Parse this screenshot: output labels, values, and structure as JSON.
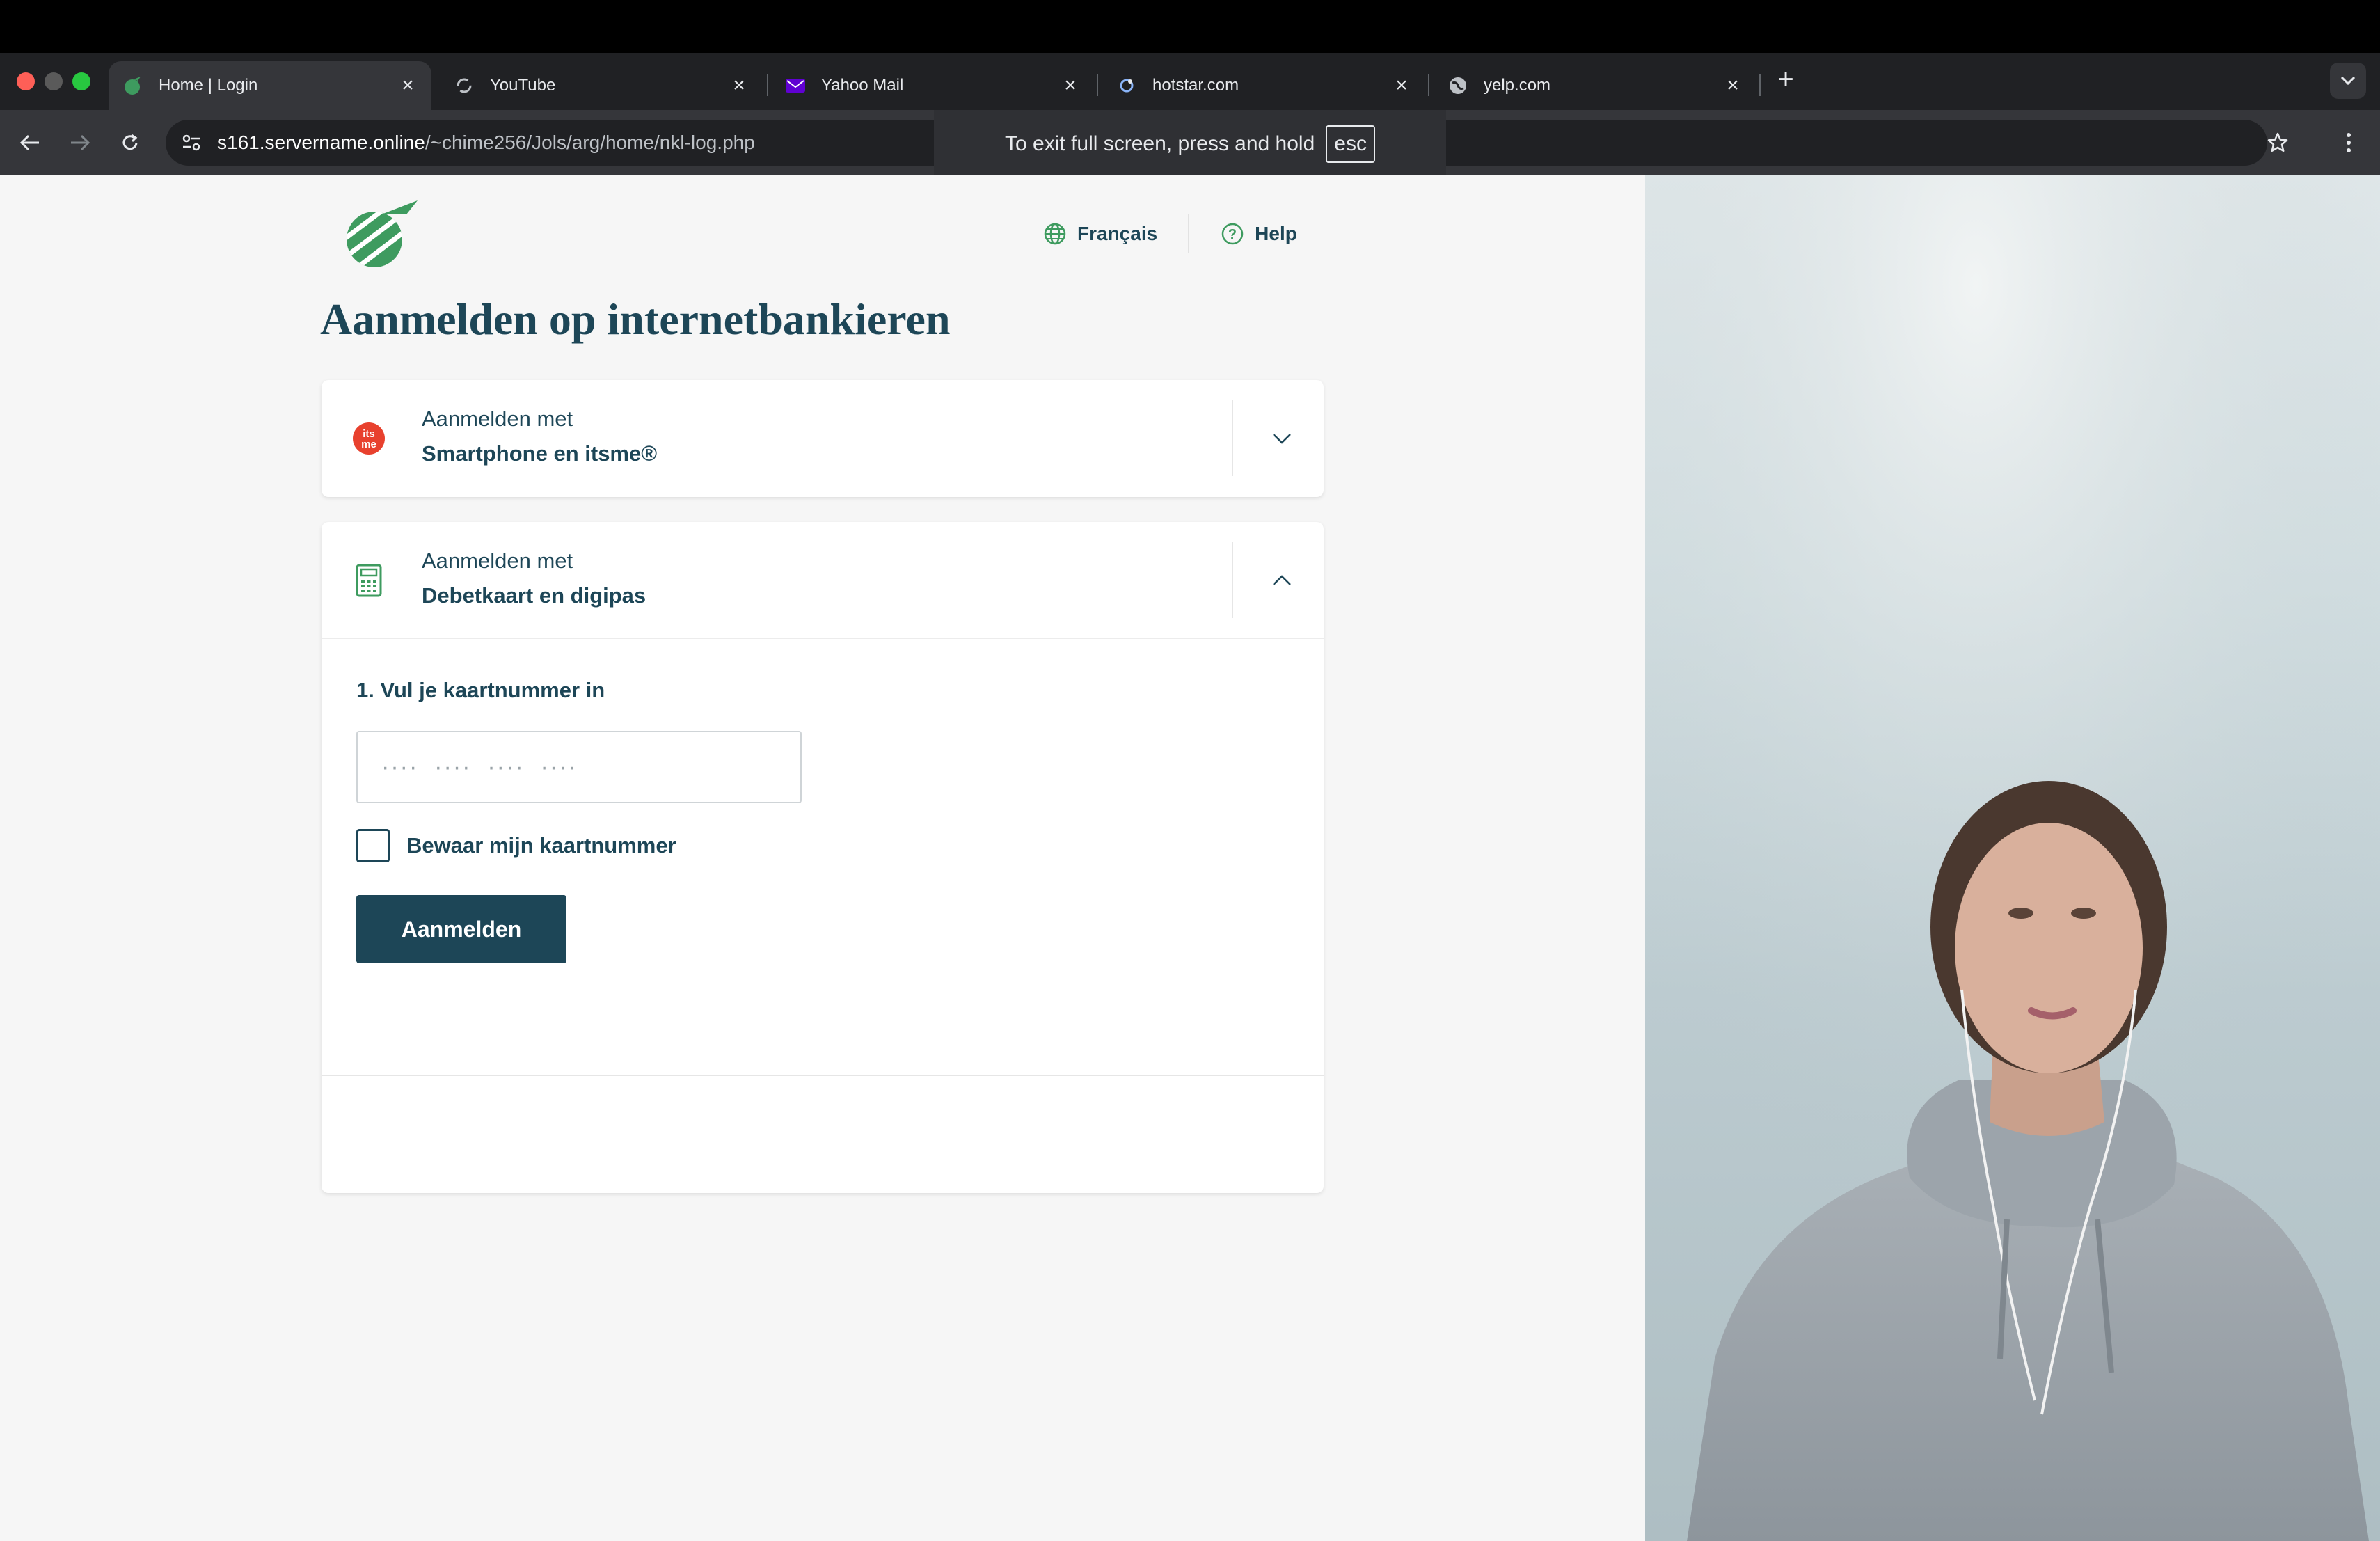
{
  "browser": {
    "tabs": [
      {
        "title": "Home | Login",
        "active": true,
        "favicon": "bank-apple-favicon-icon"
      },
      {
        "title": "YouTube",
        "active": false,
        "favicon": "youtube-favicon-icon"
      },
      {
        "title": "Yahoo Mail",
        "active": false,
        "favicon": "yahoo-mail-favicon-icon"
      },
      {
        "title": "hotstar.com",
        "active": false,
        "favicon": "hotstar-favicon-icon"
      },
      {
        "title": "yelp.com",
        "active": false,
        "favicon": "globe-favicon-icon"
      }
    ],
    "new_tab_label": "+",
    "url_host": "s161.servername.online",
    "url_path": "/~chime256/Jols/arg/home/nkl-log.php",
    "fullscreen_notice": {
      "text": "To exit full screen, press and hold",
      "key": "esc"
    }
  },
  "page": {
    "language_link": "Français",
    "help_link": "Help",
    "title": "Aanmelden op internetbankieren",
    "cards": [
      {
        "subtitle": "Aanmelden met",
        "method": "Smartphone en itsme®",
        "expanded": false,
        "icon": "itsme-icon"
      },
      {
        "subtitle": "Aanmelden met",
        "method": "Debetkaart en digipas",
        "expanded": true,
        "icon": "calculator-icon",
        "step_label": "1. Vul je kaartnummer in",
        "input_placeholder": "····  ····  ····  ····",
        "checkbox_label": "Bewaar mijn kaartnummer",
        "checkbox_checked": false,
        "submit_label": "Aanmelden"
      }
    ]
  },
  "colors": {
    "brand_dark": "#1d4657",
    "brand_green": "#3e9b5f",
    "itsme_red": "#e8412e",
    "page_bg": "#f6f6f6"
  }
}
